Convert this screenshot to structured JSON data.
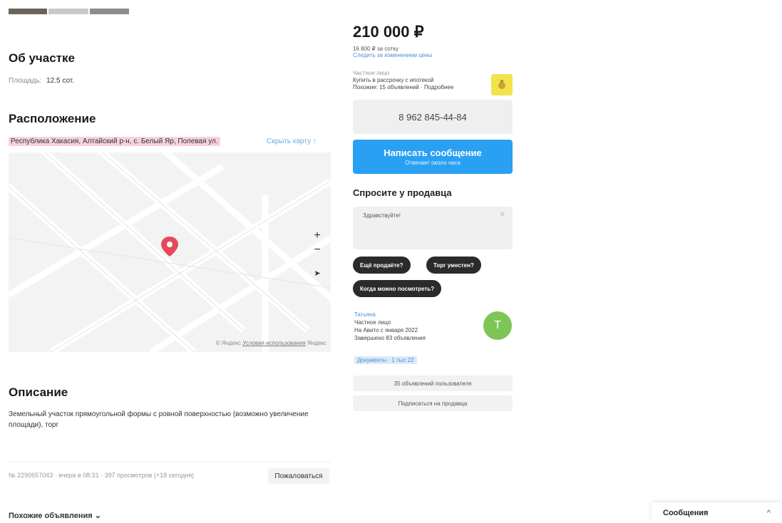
{
  "about": {
    "title": "Об участке",
    "area_label": "Площадь:",
    "area_value": "12.5 сот."
  },
  "location": {
    "title": "Расположение",
    "address": "Республика Хакасия, Алтайский р-н, с. Белый Яр, Полевая ул.",
    "hide_map": "Скрыть карту ↑",
    "map_zoom_in": "+",
    "map_zoom_out": "−",
    "map_locate": "➤",
    "map_copyright": "© Яндекс",
    "map_terms": "Условия использования",
    "map_brand": "Яндекс"
  },
  "description": {
    "title": "Описание",
    "text": "Земельный участок прямоугольной формы с ровной поверхностью (возможно увеличение площади), торг"
  },
  "ad_footer": {
    "meta": "№ 2290657043 · вчера в 08:31 · 397 просмотров (+18 сегодня)",
    "complain": "Пожаловаться"
  },
  "similar": {
    "label": "Похожие объявления ⌄"
  },
  "price": {
    "value": "210 000 ₽",
    "per_unit": "16 800 ₽ за сотку",
    "per_unit_link": "Следить за изменением цены"
  },
  "seller": {
    "label": "Частное лицо",
    "line1": "Купить в рассрочку с ипотекой",
    "line2": "Похожие: 15 объявлений · Подробнее",
    "badge_icon": "medal-icon"
  },
  "phone": {
    "value": "8 962 845-44-84"
  },
  "write": {
    "label": "Написать сообщение",
    "sub": "Отвечает около часа"
  },
  "ask": {
    "title": "Спросите у продавца",
    "input_value": "Здравствуйте!",
    "chips": [
      "Ещё продаёте?",
      "Торг уместен?",
      "Когда можно посмотреть?"
    ]
  },
  "seller2": {
    "name": "Татьяна",
    "type": "Частное лицо",
    "since": "На Авито с января 2022",
    "ads": "Завершено 83 объявления",
    "avatar_letter": "Т",
    "rating": "Документы · 1 тыс 22",
    "btn_all_ads": "35 объявлений пользователя",
    "btn_subscribe": "Подписаться на продавца"
  },
  "messenger": {
    "label": "Сообщения",
    "chevron": "^"
  },
  "colors": {
    "accent_blue": "#2aa0f3",
    "pin_red": "#e34a5a",
    "address_highlight": "#f7d1de",
    "avatar_green": "#7cc556",
    "badge_yellow": "#f1e34c"
  }
}
